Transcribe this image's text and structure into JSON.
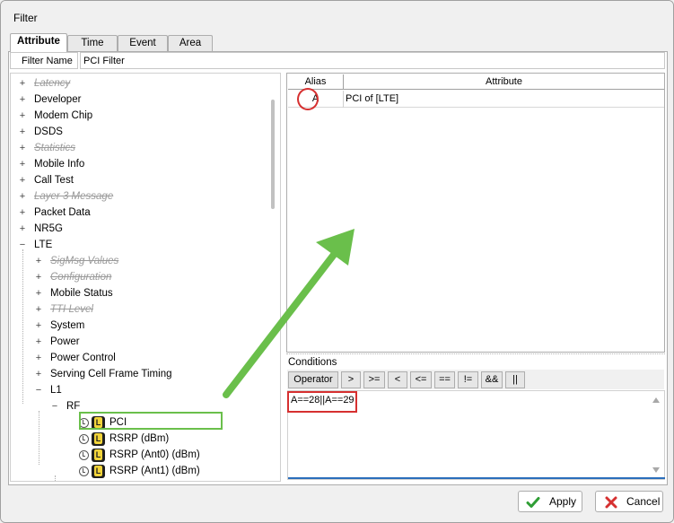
{
  "window": {
    "title": "Filter"
  },
  "tabs": [
    {
      "label": "Attribute",
      "active": true
    },
    {
      "label": "Time",
      "active": false
    },
    {
      "label": "Event",
      "active": false
    },
    {
      "label": "Area",
      "active": false
    }
  ],
  "filter_name": {
    "label": "Filter Name",
    "value": "PCI Filter"
  },
  "tree": {
    "items": [
      {
        "label": "Latency",
        "expander": "+",
        "disabled": true
      },
      {
        "label": "Developer",
        "expander": "+",
        "disabled": false
      },
      {
        "label": "Modem Chip",
        "expander": "+",
        "disabled": false
      },
      {
        "label": "DSDS",
        "expander": "+",
        "disabled": false
      },
      {
        "label": "Statistics",
        "expander": "+",
        "disabled": true
      },
      {
        "label": "Mobile Info",
        "expander": "+",
        "disabled": false
      },
      {
        "label": "Call Test",
        "expander": "+",
        "disabled": false
      },
      {
        "label": "Layer 3 Message",
        "expander": "+",
        "disabled": true
      },
      {
        "label": "Packet Data",
        "expander": "+",
        "disabled": false
      },
      {
        "label": "NR5G",
        "expander": "+",
        "disabled": false
      },
      {
        "label": "LTE",
        "expander": "−",
        "disabled": false
      },
      {
        "label": "SigMsg Values",
        "expander": "+",
        "disabled": true
      },
      {
        "label": "Configuration",
        "expander": "+",
        "disabled": true
      },
      {
        "label": "Mobile Status",
        "expander": "+",
        "disabled": false
      },
      {
        "label": "TTI Level",
        "expander": "+",
        "disabled": true
      },
      {
        "label": "System",
        "expander": "+",
        "disabled": false
      },
      {
        "label": "Power",
        "expander": "+",
        "disabled": false
      },
      {
        "label": "Power Control",
        "expander": "+",
        "disabled": false
      },
      {
        "label": "Serving Cell Frame Timing",
        "expander": "+",
        "disabled": false
      },
      {
        "label": "L1",
        "expander": "−",
        "disabled": false
      },
      {
        "label": "RF",
        "expander": "−",
        "disabled": false
      },
      {
        "label": "PCI",
        "expander": "",
        "disabled": false
      },
      {
        "label": "RSRP (dBm)",
        "expander": "",
        "disabled": false
      },
      {
        "label": "RSRP (Ant0) (dBm)",
        "expander": "",
        "disabled": false
      },
      {
        "label": "RSRP (Ant1) (dBm)",
        "expander": "",
        "disabled": false
      }
    ]
  },
  "alias_table": {
    "headers": [
      "Alias",
      "Attribute"
    ],
    "rows": [
      {
        "alias": "A",
        "attribute": "PCI of [LTE]"
      }
    ]
  },
  "conditions": {
    "title": "Conditions",
    "operator_label": "Operator",
    "operators": [
      ">",
      ">=",
      "<",
      "<=",
      "==",
      "!=",
      "&&",
      "||"
    ],
    "expression": "A==28||A==29"
  },
  "footer": {
    "apply_label": "Apply",
    "cancel_label": "Cancel"
  },
  "colors": {
    "highlight_red": "#d63030",
    "highlight_green": "#6abf4b",
    "accent_blue": "#2a6ebb"
  }
}
